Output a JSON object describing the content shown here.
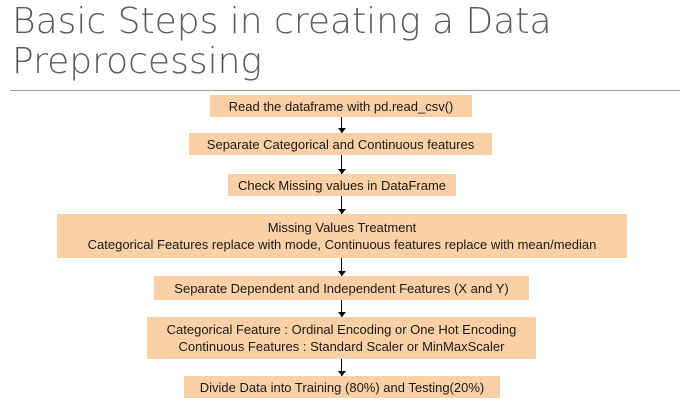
{
  "title": {
    "line1": "Basic Steps in creating a Data",
    "line2": "Preprocessing"
  },
  "steps": [
    {
      "lines": [
        "Read the dataframe with pd.read_csv()"
      ]
    },
    {
      "lines": [
        "Separate Categorical and Continuous features"
      ]
    },
    {
      "lines": [
        "Check Missing values in DataFrame"
      ]
    },
    {
      "lines": [
        "Missing Values Treatment",
        "Categorical Features replace with mode, Continuous features replace with mean/median"
      ]
    },
    {
      "lines": [
        "Separate Dependent and Independent Features (X and Y)"
      ]
    },
    {
      "lines": [
        "Categorical Feature : Ordinal Encoding or One Hot Encoding",
        "Continuous Features : Standard Scaler or MinMaxScaler"
      ]
    },
    {
      "lines": [
        "Divide Data into Training (80%) and Testing(20%)"
      ]
    }
  ],
  "colors": {
    "box_fill": "#fad0a6",
    "title_text": "#5a5a5a",
    "arrow": "#000000"
  }
}
